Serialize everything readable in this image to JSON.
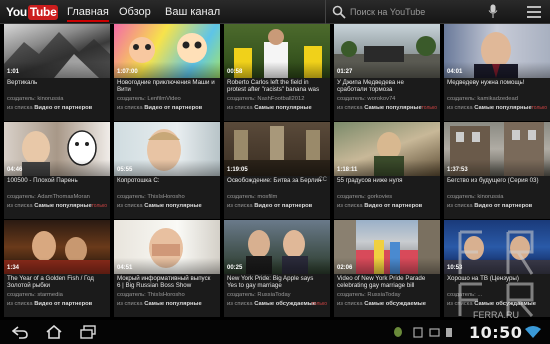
{
  "header": {
    "logo_you": "You",
    "logo_tube": "Tube",
    "nav": [
      "Главная",
      "Обзор",
      "Ваш канал"
    ],
    "active_tab": "Главная",
    "search_placeholder": "Поиск на YouTube"
  },
  "icons": {
    "search": "search-icon",
    "mic": "microphone-icon",
    "menu": "menu-icon",
    "back": "back-arrow-icon",
    "home": "home-icon",
    "recent": "recent-apps-icon",
    "wifi": "wifi-icon"
  },
  "colors": {
    "brand_red": "#cc1d1d",
    "bar": "#1a1a1a",
    "tile": "#1b1b1b",
    "tag": "#c44444"
  },
  "videos": [
    {
      "duration": "1:01",
      "title": "Вертикаль",
      "author": "создатель: kinorussia",
      "source_prefix": "из списка ",
      "source": "Видео от партнеров",
      "tag": ""
    },
    {
      "duration": "1:07:00",
      "title": "Новогодние приключения Маши и Вити",
      "author": "создатель: LenfilmVideo",
      "source_prefix": "из списка ",
      "source": "Видео от партнеров",
      "tag": ""
    },
    {
      "duration": "00:58",
      "title": "Roberto Carlos left the field in protest after \"racists\" banana was thrown at",
      "author": "создатель: NashFootball2012",
      "source_prefix": "из списка ",
      "source": "Самые популярные",
      "tag": ""
    },
    {
      "duration": "01:27",
      "title": "У Джипа Медведева не сработали тормоза",
      "author": "создатель: worokov74",
      "source_prefix": "из списка ",
      "source": "Самые популярные",
      "tag": "только"
    },
    {
      "duration": "04:01",
      "title": "Медведеву нужна помощь!",
      "author": "создатель: kamikadzedead",
      "source_prefix": "из списка ",
      "source": "Самые популярные",
      "tag": "только"
    },
    {
      "duration": "04:46",
      "title": "100500 - Плохой Парень",
      "author": "создатель: AdamThomasMoran",
      "source_prefix": "из списка ",
      "source": "Самые популярные",
      "tag": "только"
    },
    {
      "duration": "05:55",
      "title": "Копротошка С:",
      "author": "создатель: ThisIsHorosho",
      "source_prefix": "из списка ",
      "source": "Самые популярные",
      "tag": ""
    },
    {
      "duration": "1:19:05",
      "title": "Освобождение: Битва за Берлин",
      "author": "создатель: mosfilm",
      "source_prefix": "из списка ",
      "source": "Видео от партнеров",
      "tag": "",
      "cc": "CC"
    },
    {
      "duration": "1:18:11",
      "title": "55 градусов ниже нуля",
      "author": "создатель: gorkovies",
      "source_prefix": "из списка ",
      "source": "Видео от партнеров",
      "tag": ""
    },
    {
      "duration": "1:37:53",
      "title": "Бегство из будущего (Серия 03)",
      "author": "создатель: kinorussia",
      "source_prefix": "из списка ",
      "source": "Видео от партнеров",
      "tag": ""
    },
    {
      "duration": "1:34",
      "title": "The Year of a Golden Fish / Год Золотой рыбки",
      "author": "создатель: starmedia",
      "source_prefix": "из списка ",
      "source": "Видео от партнеров",
      "tag": ""
    },
    {
      "duration": "04:51",
      "title": "Мокрый информативный выпуск 6 | Big Russian Boss Show",
      "author": "создатель: ThisIsHorosho",
      "source_prefix": "из списка ",
      "source": "Самые популярные",
      "tag": ""
    },
    {
      "duration": "00:25",
      "title": "New York Pride: Big Apple says Yes to gay marriage",
      "author": "создатель: RussiaToday",
      "source_prefix": "из списка ",
      "source": "Самые обсуждаемые",
      "tag": "только"
    },
    {
      "duration": "02:06",
      "title": "Video of New York Pride Parade celebrating gay marriage bill",
      "author": "создатель: RussiaToday",
      "source_prefix": "из списка ",
      "source": "Самые обсуждаемые",
      "tag": ""
    },
    {
      "duration": "10:53",
      "title": "Хорошо на ТВ (Цензуры)",
      "author": "создатель: ...",
      "source_prefix": "из списка ",
      "source": "Самые обсуждаемые",
      "tag": ""
    }
  ],
  "statusbar": {
    "clock": "10:50"
  },
  "watermark": {
    "text": "FERRA.RU"
  }
}
